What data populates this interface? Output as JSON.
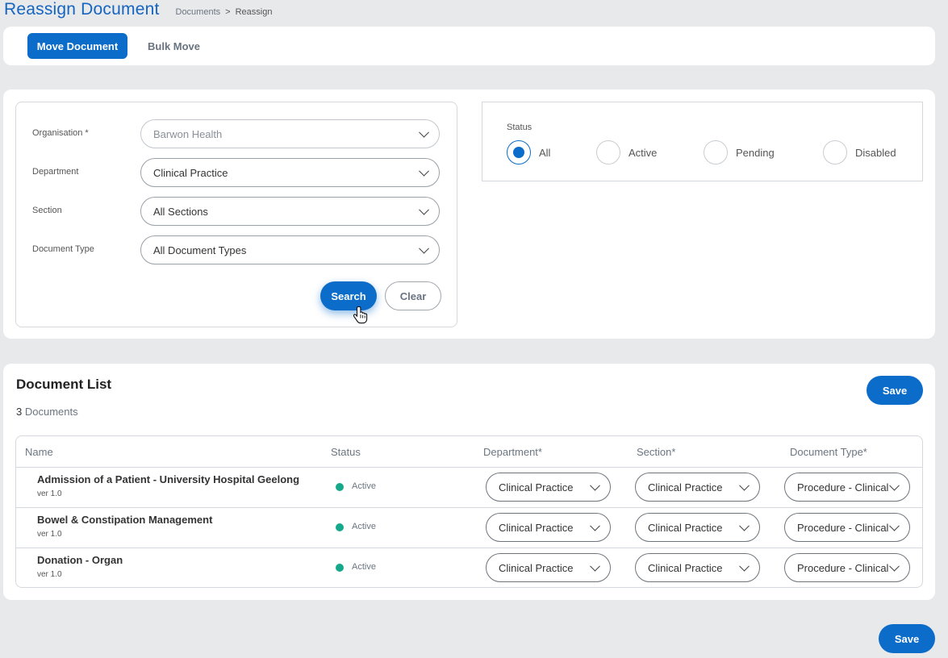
{
  "header": {
    "title": "Reassign Document",
    "breadcrumb": [
      "Documents",
      ">",
      "Reassign"
    ]
  },
  "tabs": [
    {
      "label": "Move Document",
      "active": true
    },
    {
      "label": "Bulk Move",
      "active": false
    }
  ],
  "filters": {
    "organisation": {
      "label": "Organisation *",
      "value": "Barwon Health",
      "disabled": true
    },
    "department": {
      "label": "Department",
      "value": "Clinical Practice"
    },
    "section": {
      "label": "Section",
      "value": "All Sections"
    },
    "document_type": {
      "label": "Document Type",
      "value": "All Document Types"
    },
    "search_label": "Search",
    "clear_label": "Clear"
  },
  "status_filter": {
    "label": "Status",
    "options": [
      {
        "label": "All",
        "selected": true
      },
      {
        "label": "Active",
        "selected": false
      },
      {
        "label": "Pending",
        "selected": false
      },
      {
        "label": "Disabled",
        "selected": false
      }
    ]
  },
  "document_list": {
    "title": "Document List",
    "count": "3",
    "count_suffix": "Documents",
    "save_label": "Save",
    "columns": [
      "Name",
      "Status",
      "Department*",
      "Section*",
      "Document Type*"
    ],
    "rows": [
      {
        "name": "Admission of a Patient - University Hospital Geelong",
        "version": "ver 1.0",
        "status": "Active",
        "department": "Clinical Practice",
        "section": "Clinical Practice",
        "document_type": "Procedure - Clinical"
      },
      {
        "name": "Bowel & Constipation Management",
        "version": "ver 1.0",
        "status": "Active",
        "department": "Clinical Practice",
        "section": "Clinical Practice",
        "document_type": "Procedure - Clinical"
      },
      {
        "name": "Donation - Organ",
        "version": "ver 1.0",
        "status": "Active",
        "department": "Clinical Practice",
        "section": "Clinical Practice",
        "document_type": "Procedure - Clinical"
      }
    ]
  },
  "footer": {
    "save_label": "Save"
  },
  "colors": {
    "accent": "#0b6cc9",
    "title": "#1565c0",
    "status_active": "#16a88a",
    "background": "#e8e9eb"
  }
}
